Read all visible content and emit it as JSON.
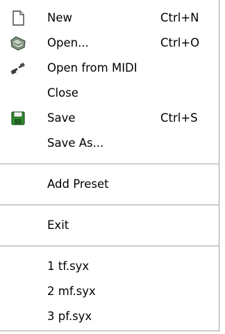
{
  "menu": {
    "items": [
      {
        "label": "New",
        "shortcut": "Ctrl+N",
        "icon": "new-document-icon"
      },
      {
        "label": "Open...",
        "shortcut": "Ctrl+O",
        "icon": "open-folder-icon"
      },
      {
        "label": "Open from MIDI",
        "shortcut": "",
        "icon": "midi-cable-icon"
      },
      {
        "label": "Close",
        "shortcut": "",
        "icon": ""
      },
      {
        "label": "Save",
        "shortcut": "Ctrl+S",
        "icon": "save-disk-icon"
      },
      {
        "label": "Save As...",
        "shortcut": "",
        "icon": ""
      }
    ],
    "add_preset": "Add Preset",
    "exit": "Exit",
    "recent_files": [
      "1 tf.syx",
      "2 mf.syx",
      "3 pf.syx"
    ]
  },
  "colors": {
    "separator": "#a0a0a0",
    "save_icon_green": "#2f8f2f"
  }
}
